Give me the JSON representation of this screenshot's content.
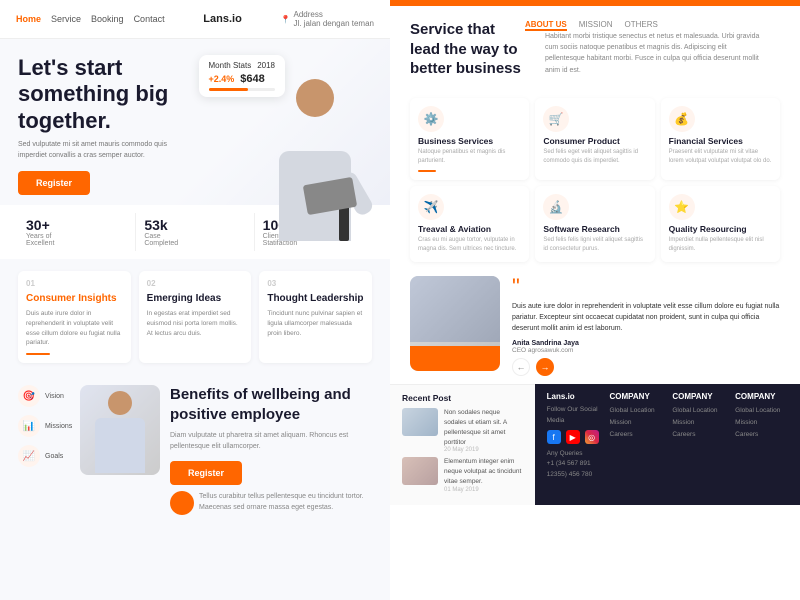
{
  "left": {
    "nav": {
      "links": [
        "Home",
        "Service",
        "Booking",
        "Contact"
      ],
      "logo": "Lans.io",
      "address": "Address",
      "address_sub": "Jl. jalan dengan teman"
    },
    "hero": {
      "title": "Let's start something big together.",
      "subtitle": "Sed vulputate mi sit amet mauris commodo quis imperdiet convallis a cras semper auctor.",
      "register_btn": "Register",
      "card_label": "Month Stats",
      "card_year": "2018",
      "card_pct": "+2.4%",
      "card_value": "$648"
    },
    "stats": [
      {
        "num": "30+",
        "label1": "Years of",
        "label2": "Excellent"
      },
      {
        "num": "53k",
        "label1": "Case",
        "label2": "Completed"
      },
      {
        "num": "100%",
        "label1": "Client",
        "label2": "Statifaction"
      }
    ],
    "features": [
      {
        "num": "01",
        "title": "Consumer Insights",
        "desc": "Duis aute irure dolor in reprehenderit in voluptate velit esse cillum dolore eu fugiat nulla pariatur.",
        "active": true
      },
      {
        "num": "02",
        "title": "Emerging Ideas",
        "desc": "In egestas erat imperdiet sed euismod nisi porta lorem mollis. At lectus arcu duis.",
        "active": false
      },
      {
        "num": "03",
        "title": "Thought Leadership",
        "desc": "Tincidunt nunc pulvinar sapien et ligula ullamcorper malesuada proin libero.",
        "active": false
      }
    ],
    "benefits": {
      "title": "Benefits of wellbeing and positive employee",
      "desc": "Diam vulputate ut pharetra sit amet aliquam. Rhoncus est pellentesque elit ullamcorper.",
      "register_btn": "Register",
      "icons": [
        {
          "label": "Vision",
          "icon": "🎯"
        },
        {
          "label": "Missions",
          "icon": "📊"
        },
        {
          "label": "Goals",
          "icon": "📈"
        }
      ],
      "testimonial": "Tellus curabitur tellus pellentesque eu tincidunt tortor. Maecenas sed ornare massa eget egestas."
    }
  },
  "right": {
    "top_bar": true,
    "service": {
      "title": "Service that lead the way to better business",
      "tabs": [
        "ABOUT US",
        "MISSION",
        "OTHERS"
      ],
      "desc": "Habitant morbi tristique senectus et netus et malesuada. Urbi gravida cum sociis natoque penatibus et magnis dis. Adipiscing elit pellentesque habitant morbi. Fusce in culpa qui officia deserunt mollit anim id est.",
      "cards": [
        {
          "icon": "⚙️",
          "name": "Business Services",
          "desc": "Natoque penatibus et magnis dis parturient."
        },
        {
          "icon": "🛒",
          "name": "Consumer Product",
          "desc": "Sed felis eget velit aliquet sagittis id commodo quis dis imperdiet."
        },
        {
          "icon": "💰",
          "name": "Financial Services",
          "desc": "Praesent elit vulputate mi sit vitae lorem volutpat volutpat volutpat olo do."
        },
        {
          "icon": "✈️",
          "name": "Treaval & Aviation",
          "desc": "Cras eu mi augue tortor, vulputate in magna dis. Sem ultrices nec tincture."
        },
        {
          "icon": "🔬",
          "name": "Software Research",
          "desc": "Sed felis felis ligni velit aliquet sagittis id consectetur purus."
        },
        {
          "icon": "⭐",
          "name": "Quality Resourcing",
          "desc": "Imperdiet nulla pellentesque elit nisl dignissim."
        }
      ]
    },
    "testimonial": {
      "quote": "Duis aute iure dolor in reprehenderit in voluptate velit esse cillum dolore eu fugiat nulla pariatur. Excepteur sint occaecat cupidatat non proident, sunt in culpa qui officia deserunt mollit anim id est laborum.",
      "author": "Anita Sandrina Jaya",
      "role": "CEO agrosawuk.com"
    },
    "recent_posts": {
      "title": "Recent Post",
      "posts": [
        {
          "text": "Non sodales neque sodales ut etiam sit. A pellentesque sit amet porttitor",
          "date": "20 May 2019"
        },
        {
          "text": "Elementum integer enim neque volutpat ac tincidunt vitae semper.",
          "date": "01 May 2019"
        }
      ]
    },
    "footer": {
      "brand": "Lans.io",
      "brand_desc": "Follow Our Social Media",
      "any_queries": "Any Queries",
      "phone": "+1 (34 567 891 12355) 456 780",
      "companies": [
        {
          "title": "COMPANY",
          "links": [
            "Global Location",
            "Mission",
            "Careers"
          ]
        },
        {
          "title": "COMPANY",
          "links": [
            "Global Location",
            "Mission",
            "Careers"
          ]
        },
        {
          "title": "COMPANY",
          "links": [
            "Global Location",
            "Mission",
            "Careers"
          ]
        }
      ]
    }
  }
}
